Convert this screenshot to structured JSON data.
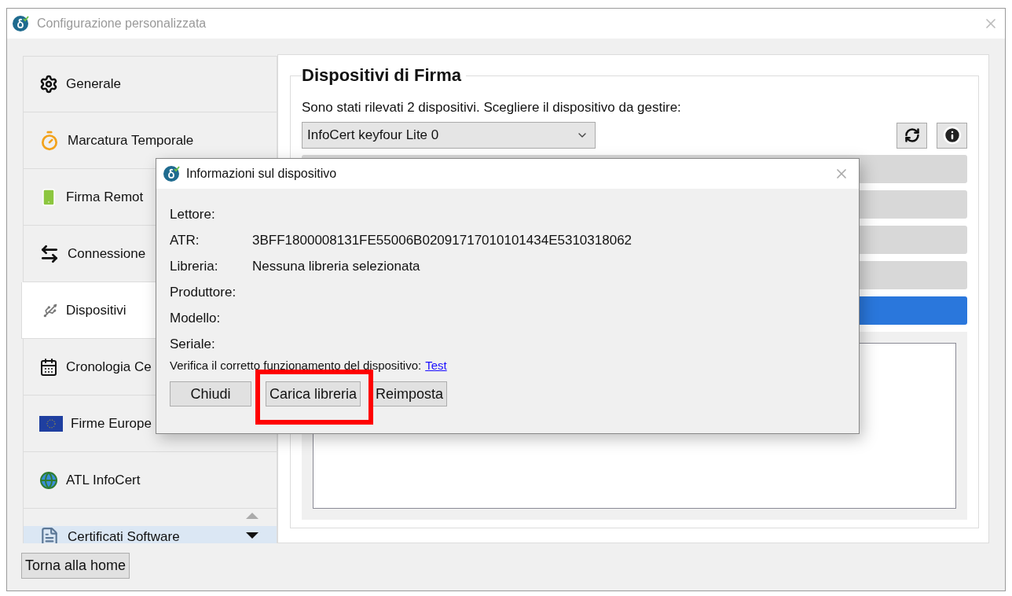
{
  "window": {
    "title": "Configurazione personalizzata"
  },
  "sidebar": {
    "items": [
      {
        "label": "Generale",
        "selected": false,
        "hovered": false
      },
      {
        "label": "Marcatura Temporale",
        "selected": false,
        "hovered": false
      },
      {
        "label": "Firma Remot",
        "selected": false,
        "hovered": false
      },
      {
        "label": "Connessione",
        "selected": false,
        "hovered": false
      },
      {
        "label": "Dispositivi",
        "selected": true,
        "hovered": false
      },
      {
        "label": "Cronologia Ce",
        "selected": false,
        "hovered": false
      },
      {
        "label": "Firme Europe",
        "selected": false,
        "hovered": false
      },
      {
        "label": "ATL InfoCert",
        "selected": false,
        "hovered": false
      },
      {
        "label": "Certificati Software",
        "selected": false,
        "hovered": true
      }
    ]
  },
  "panel": {
    "title": "Dispositivi di Firma",
    "prompt": "Sono stati rilevati 2 dispositivi. Scegliere il dispositivo da gestire:",
    "device_select": {
      "value": "InfoCert keyfour Lite 0"
    },
    "action_buttons": [
      {
        "kind": "default"
      },
      {
        "kind": "default"
      },
      {
        "kind": "default"
      },
      {
        "kind": "default"
      },
      {
        "kind": "primary"
      }
    ]
  },
  "home_button": "Torna alla home",
  "dialog": {
    "title": "Informazioni sul dispositivo",
    "fields": [
      {
        "label": "Lettore:"
      },
      {
        "label": "ATR:",
        "value": "3BFF1800008131FE55006B02091717010101434E5310318062"
      },
      {
        "label": "Libreria:",
        "value": "Nessuna libreria selezionata"
      },
      {
        "label": "Produttore:"
      },
      {
        "label": "Modello:"
      },
      {
        "label": "Seriale:"
      }
    ],
    "verify_text": "Verifica il corretto funzionamento del dispositivo:",
    "verify_link": "Test",
    "buttons": [
      "Chiudi",
      "Carica libreria",
      "Reimposta"
    ]
  }
}
